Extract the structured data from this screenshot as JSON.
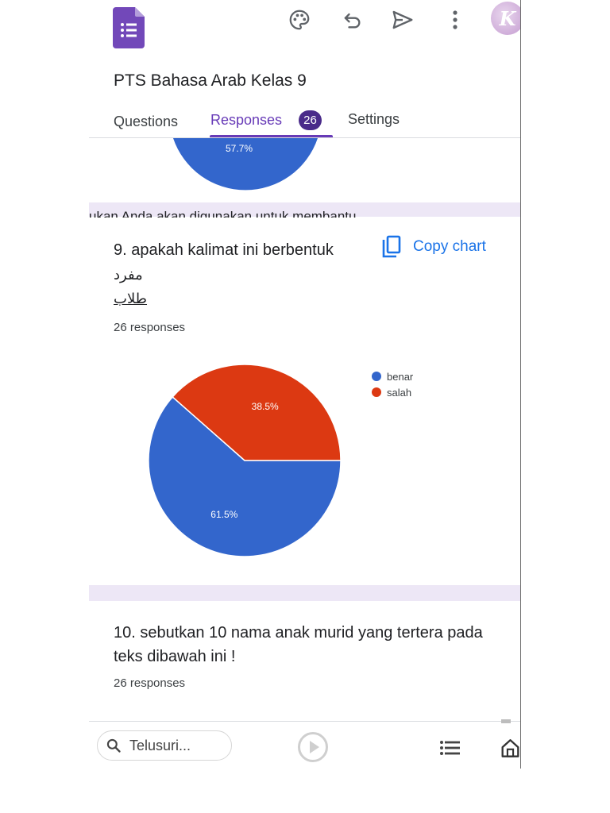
{
  "form": {
    "title": "PTS Bahasa Arab Kelas 9"
  },
  "tabs": [
    {
      "label": "Questions"
    },
    {
      "label": "Responses",
      "badge": "26",
      "active": true
    },
    {
      "label": "Settings"
    }
  ],
  "header_icons": [
    "forms-app-icon",
    "palette-icon",
    "undo-icon",
    "send-icon",
    "more-vert-icon",
    "avatar"
  ],
  "avatar": {
    "letter": "K"
  },
  "previous_question": {
    "chart_data": {
      "type": "pie",
      "data_labels": [
        "57.7%"
      ]
    },
    "cut_text": "ukan Anda akan digunakan untuk membantu"
  },
  "question9": {
    "title": "9. apakah kalimat ini berbentuk",
    "arabic_line1": "مفرد",
    "arabic_line2": "طلاب",
    "responses": "26 responses",
    "copy_chart_label": "Copy chart",
    "chart_data": {
      "type": "pie",
      "categories": [
        "benar",
        "salah"
      ],
      "values": [
        61.5,
        38.5
      ],
      "data_labels": [
        "61.5%",
        "38.5%"
      ],
      "colors": [
        "#3366cc",
        "#dc3912"
      ],
      "legend": "right"
    }
  },
  "question10": {
    "title": "10. sebutkan 10 nama anak murid yang tertera pada teks dibawah ini !",
    "responses": "26 responses"
  },
  "bottom_bar": {
    "search_placeholder": "Telusuri...",
    "icons": [
      "search-icon",
      "play-icon",
      "list-icon",
      "home-icon"
    ]
  },
  "colors": {
    "accent": "#673ab7",
    "badge": "#4a2b8a",
    "link": "#1a73e8",
    "band": "#ede7f6"
  }
}
